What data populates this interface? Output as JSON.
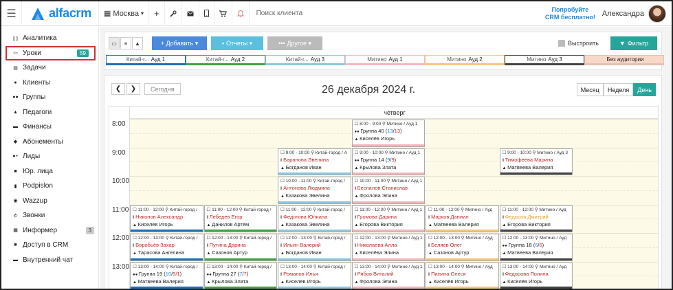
{
  "topbar": {
    "logo": "alfacrm",
    "city": "Москва",
    "search_placeholder": "Поиск клиента",
    "promo_line1": "Попробуйте",
    "promo_line2": "CRM бесплатно!",
    "username": "Александра"
  },
  "sidebar": {
    "items": [
      {
        "label": "Аналитика",
        "icon": "book-icon"
      },
      {
        "label": "Уроки",
        "icon": "calendar-icon",
        "badge": "59"
      },
      {
        "label": "Задачи",
        "icon": "clipboard-icon"
      },
      {
        "label": "Клиенты",
        "icon": "user-icon"
      },
      {
        "label": "Группы",
        "icon": "users-icon"
      },
      {
        "label": "Педагоги",
        "icon": "graduation-cap-icon"
      },
      {
        "label": "Финансы",
        "icon": "money-icon"
      },
      {
        "label": "Абонементы",
        "icon": "ticket-icon"
      },
      {
        "label": "Лиды",
        "icon": "user-plus-icon"
      },
      {
        "label": "Юр. лица",
        "icon": "briefcase-icon"
      },
      {
        "label": "Podpislon",
        "icon": "file-icon"
      },
      {
        "label": "Wazzup",
        "icon": "whatsapp-icon"
      },
      {
        "label": "Звонки",
        "icon": "phone-icon"
      },
      {
        "label": "Информер",
        "icon": "inbox-icon",
        "badge": "3"
      },
      {
        "label": "Доступ в CRM",
        "icon": "lock-icon"
      },
      {
        "label": "Внутренний чат",
        "icon": "chat-icon"
      }
    ]
  },
  "toolbar": {
    "add_label": "+ Добавить ▾",
    "reports_label": "Отчеты ▾",
    "other_label": "Другое ▾",
    "align_label": "Выстроить",
    "filter_label": "Фильтр"
  },
  "rooms": [
    {
      "place": "Китай-г...",
      "name": "Ауд 1",
      "color": "#1e6fb8"
    },
    {
      "place": "Китай-г...",
      "name": "Ауд 2",
      "color": "#43a047"
    },
    {
      "place": "Китай-г...",
      "name": "Ауд 3",
      "color": "#8ec6e0"
    },
    {
      "place": "Митино",
      "name": "Ауд 1",
      "color": "#f3b6bd"
    },
    {
      "place": "Митино",
      "name": "Ауд 2",
      "color": "#f4c77a"
    },
    {
      "place": "Митино",
      "name": "Ауд 3",
      "color": "#444444"
    },
    {
      "place": "",
      "name": "Без аудитории",
      "color": "#f8d8c8"
    }
  ],
  "calendar": {
    "today_label": "Сегодня",
    "date_title": "26 декабря 2024 г.",
    "views": [
      "Месяц",
      "Неделя",
      "День"
    ],
    "day_header": "четверг",
    "hours": [
      "8:00",
      "9:00",
      "10:00",
      "11:00",
      "12:00",
      "13:00"
    ]
  },
  "events": [
    {
      "time": "8:00 - 9:00",
      "loc": "Митино / Ауд 1",
      "name": "Группа 40",
      "count": "13",
      "count2": "13",
      "group": true,
      "teacher": "Киселёв Игорь",
      "col": 3,
      "row": 0,
      "color": "#f3b6bd"
    },
    {
      "time": "9:00 - 10:00",
      "loc": "Китай-город / А",
      "name": "Баранова Эвелина",
      "teacher": "Богданов Иван",
      "col": 2,
      "row": 1,
      "color": "#8ec6e0"
    },
    {
      "time": "9:00 - 10:00",
      "loc": "Митино / Ауд 1",
      "name": "Группа 14",
      "count": "9",
      "count2": "9",
      "group": true,
      "teacher": "Крылова Злата",
      "col": 3,
      "row": 1,
      "color": "#f3b6bd"
    },
    {
      "time": "9:00 - 10:00",
      "loc": "Митино / Ауд 3",
      "name": "Тимофеева Марина",
      "teacher": "Матвеева Валерия",
      "col": 5,
      "row": 1,
      "color": "#444444"
    },
    {
      "time": "10:00 - 11:00",
      "loc": "Китай-город /",
      "name": "Антонова Людмила",
      "teacher": "Казакова Эвелина",
      "col": 2,
      "row": 2,
      "color": "#8ec6e0"
    },
    {
      "time": "10:00 - 11:00",
      "loc": "Митино / Ауд 1",
      "name": "Беспалов Станислав",
      "teacher": "Фролова Элина",
      "col": 3,
      "row": 2,
      "color": "#f3b6bd"
    },
    {
      "time": "11:00 - 12:00",
      "loc": "Китай-город /",
      "name": "Никонов Александр",
      "teacher": "Киселёв Игорь",
      "col": 0,
      "row": 3,
      "color": "#1e6fb8"
    },
    {
      "time": "11:00 - 12:00",
      "loc": "Китай-город /",
      "name": "Лебедев Егор",
      "teacher": "Данилов Артём",
      "col": 1,
      "row": 3,
      "color": "#43a047"
    },
    {
      "time": "11:00 - 12:00",
      "loc": "Китай-город /",
      "name": "Федотова Юлиана",
      "teacher": "Казакова Эвелина",
      "col": 2,
      "row": 3,
      "color": "#8ec6e0"
    },
    {
      "time": "11:00 - 12:00",
      "loc": "Митино / Ауд 1",
      "name": "Громова Дарина",
      "teacher": "Егорова Виктория",
      "col": 3,
      "row": 3,
      "color": "#f3b6bd"
    },
    {
      "time": "11:00 - 12:00",
      "loc": "Митино / Ауд",
      "name": "Марков Даниил",
      "teacher": "Матвеева Валерия",
      "col": 4,
      "row": 3,
      "color": "#f4c77a"
    },
    {
      "time": "11:00 - 12:00",
      "loc": "Митино / Ауд",
      "name": "Федоров Дмитрий",
      "teacher": "Егорова Виктория",
      "col": 5,
      "row": 3,
      "color": "#444444",
      "nameColor": "#f0a020"
    },
    {
      "time": "12:00 - 13:00",
      "loc": "Китай-город /",
      "name": "Воробьёв Захар",
      "teacher": "Тарасова Ангелина",
      "col": 0,
      "row": 4,
      "color": "#1e6fb8"
    },
    {
      "time": "12:00 - 13:00",
      "loc": "Китай-город /",
      "name": "Путина Дарина",
      "teacher": "Сазонов Артур",
      "col": 1,
      "row": 4,
      "color": "#43a047"
    },
    {
      "time": "12:00 - 13:00",
      "loc": "Китай-город /",
      "name": "Ильин Валерий",
      "teacher": "Богданов Иван",
      "col": 2,
      "row": 4,
      "color": "#8ec6e0"
    },
    {
      "time": "12:00 - 13:00",
      "loc": "Митино / Ауд 1",
      "name": "Николаева Алла",
      "teacher": "Киселёва Элина",
      "col": 3,
      "row": 4,
      "color": "#f3b6bd"
    },
    {
      "time": "12:00 - 13:00",
      "loc": "Митино / Ауд",
      "name": "Беляев Олег",
      "teacher": "Сазонов Артур",
      "col": 4,
      "row": 4,
      "color": "#f4c77a"
    },
    {
      "time": "12:00 - 13:00",
      "loc": "Митино / Ауд",
      "name": "Группа 18",
      "count": "6",
      "count2": "6",
      "group": true,
      "teacher": "Матвеева Валерия",
      "col": 5,
      "row": 4,
      "color": "#444444"
    },
    {
      "time": "13:00 - 14:00",
      "loc": "Китай-город /",
      "name": "Группа 19",
      "count": "10",
      "count2": "9/1",
      "group": true,
      "teacher": "Матвеева Валерия",
      "col": 0,
      "row": 5,
      "color": "#1e6fb8"
    },
    {
      "time": "13:00 - 14:00",
      "loc": "Китай-город /",
      "name": "Группа 27",
      "count": "7",
      "count2": "7",
      "group": true,
      "teacher": "Крылова Злата",
      "col": 1,
      "row": 5,
      "color": "#43a047"
    },
    {
      "time": "13:00 - 14:00",
      "loc": "Китай-город /",
      "name": "Романов Илья",
      "teacher": "Киселёв Игорь",
      "col": 2,
      "row": 5,
      "color": "#8ec6e0"
    },
    {
      "time": "13:00 - 14:00",
      "loc": "Митино / Ауд 1",
      "name": "Рябов Виталий",
      "teacher": "Фролова Элина",
      "col": 3,
      "row": 5,
      "color": "#f3b6bd"
    },
    {
      "time": "13:00 - 14:00",
      "loc": "Митино / Ауд",
      "name": "Панина Олеся",
      "teacher": "Киселёв Игорь",
      "col": 4,
      "row": 5,
      "color": "#f4c77a"
    },
    {
      "time": "13:00 - 14:00",
      "loc": "Митино / Ауд",
      "name": "Федорова Полина",
      "teacher": "Киселёв Игорь",
      "col": 5,
      "row": 5,
      "color": "#444444"
    }
  ]
}
